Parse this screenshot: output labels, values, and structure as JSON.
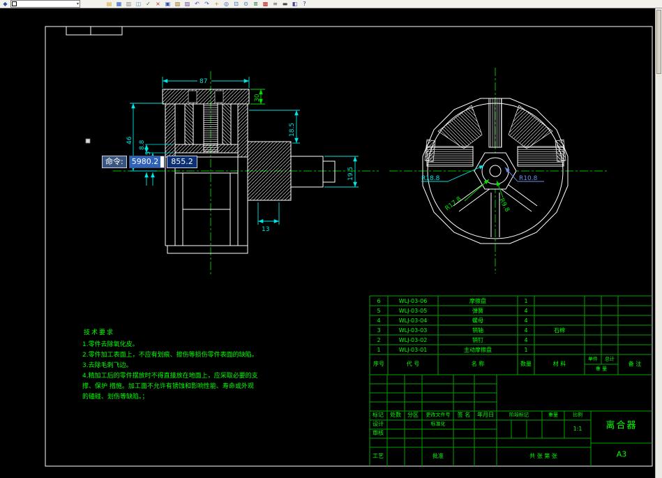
{
  "window": {
    "toolbar": {
      "app_icon": {
        "name": "app-icon",
        "glyph": "◆",
        "color": "#2f4f9e"
      },
      "combo_value": "",
      "icons": [
        {
          "name": "open-icon",
          "glyph": "▤",
          "color": "#d8a820"
        },
        {
          "name": "save-icon",
          "glyph": "▦",
          "color": "#2858c8"
        },
        {
          "name": "plot-icon",
          "glyph": "▥",
          "color": "#888888"
        },
        {
          "name": "plot-preview-icon",
          "glyph": "◫",
          "color": "#50a0c0"
        },
        {
          "name": "spell-check-icon",
          "glyph": "✓",
          "color": "#208020"
        },
        {
          "name": "cut-icon",
          "glyph": "×",
          "color": "#b03030"
        },
        {
          "name": "copy-icon",
          "glyph": "▣",
          "color": "#3050b0"
        },
        {
          "name": "paste-icon",
          "glyph": "▧",
          "color": "#a07820"
        },
        {
          "name": "match-properties-icon",
          "glyph": "▨",
          "color": "#7050a0"
        },
        {
          "name": "undo-icon",
          "glyph": "↶",
          "color": "#2858c8"
        },
        {
          "name": "redo-icon",
          "glyph": "↷",
          "color": "#2858c8"
        },
        {
          "name": "pan-icon",
          "glyph": "+",
          "color": "#c89000"
        },
        {
          "name": "zoom-realtime-icon",
          "glyph": "◎",
          "color": "#3060c0"
        },
        {
          "name": "zoom-window-icon",
          "glyph": "⊡",
          "color": "#3060c0"
        },
        {
          "name": "zoom-previous-icon",
          "glyph": "⊙",
          "color": "#3060c0"
        },
        {
          "name": "layers-icon",
          "glyph": "≣",
          "color": "#208040"
        },
        {
          "name": "layer-color-icon",
          "glyph": "▩",
          "color": "#c02020"
        },
        {
          "name": "linetype-icon",
          "glyph": "≡",
          "color": "#666666"
        },
        {
          "name": "lineweight-icon",
          "glyph": "▬",
          "color": "#444444"
        },
        {
          "name": "properties-icon",
          "glyph": "◧",
          "color": "#4040a0"
        },
        {
          "name": "help-icon",
          "glyph": "?",
          "color": "#203080"
        }
      ]
    }
  },
  "tooltip": {
    "label": "命令:",
    "value1": "5980.2",
    "value2": "855.2"
  },
  "dims": {
    "top_width": "87",
    "flange": "30",
    "step": "18.5",
    "shaft": "19.5",
    "height": "46",
    "p1": "8.8",
    "p2": "8.5",
    "bottom": "13",
    "r1": "R18.8",
    "r2": "R17.8",
    "r3": "R10.8",
    "r4": "R9.8"
  },
  "tech": {
    "title": "技术要求",
    "items": [
      "1.零件去除氧化皮。",
      "2.零件加工表面上，不应有划痕、擦伤等损伤零件表面的缺陷。",
      "3.去除毛刺飞边。",
      "4.精加工后的零件摆放时不得直接放在地面上，应采取必要的支撑、保护 措施。加工面不允许有锈蚀和影响性能、寿命或外观的磕碰、划伤等缺陷。；"
    ]
  },
  "parts": {
    "headers": {
      "seq": "序号",
      "code": "代 号",
      "name": "名 称",
      "qty": "数量",
      "material": "材 料",
      "unit": "单件",
      "total": "总计",
      "weight": "重 量",
      "notes": "备 注"
    },
    "rows": [
      {
        "seq": "6",
        "code": "WLJ-03-06",
        "name": "摩擦盘",
        "qty": "1",
        "material": "",
        "unit": "",
        "total": "",
        "notes": ""
      },
      {
        "seq": "5",
        "code": "WLJ-03-05",
        "name": "弹簧",
        "qty": "4",
        "material": "",
        "unit": "",
        "total": "",
        "notes": ""
      },
      {
        "seq": "4",
        "code": "WLJ-03-04",
        "name": "螺母",
        "qty": "4",
        "material": "",
        "unit": "",
        "total": "",
        "notes": ""
      },
      {
        "seq": "3",
        "code": "WLJ-03-03",
        "name": "销轴",
        "qty": "4",
        "material": "石棉",
        "unit": "",
        "total": "",
        "notes": ""
      },
      {
        "seq": "2",
        "code": "WLJ-03-02",
        "name": "销钉",
        "qty": "4",
        "material": "",
        "unit": "",
        "total": "",
        "notes": ""
      },
      {
        "seq": "1",
        "code": "WLJ-03-01",
        "name": "主动摩擦盘",
        "qty": "1",
        "material": "",
        "unit": "",
        "total": "",
        "notes": ""
      }
    ]
  },
  "block": {
    "mark": "标记",
    "count": "处数",
    "zone": "分区",
    "doc": "更改文件号",
    "sign": "签 名",
    "date": "年月日",
    "design": "设计",
    "standard": "标准化",
    "review": "审核",
    "process": "工艺",
    "approve": "批准",
    "stage": "阶段标记",
    "weight": "重量",
    "scale": "比例",
    "scale_value": "1:1",
    "sheets": "共 张 第 张",
    "title": "离合器",
    "size": "A3"
  },
  "colors": {
    "canvas_bg": "#000000",
    "geometry": "#ffffff",
    "centerline": "#00c000",
    "dimension_cyan": "#00e5e5",
    "dimension_green": "#00e000",
    "dimension_blue": "#6f8fe8",
    "annotation_green": "#00ff00",
    "table_grid": "#00a400",
    "tooltip_selection": "#2f62b8",
    "tooltip_dark": "#0d2f73"
  }
}
